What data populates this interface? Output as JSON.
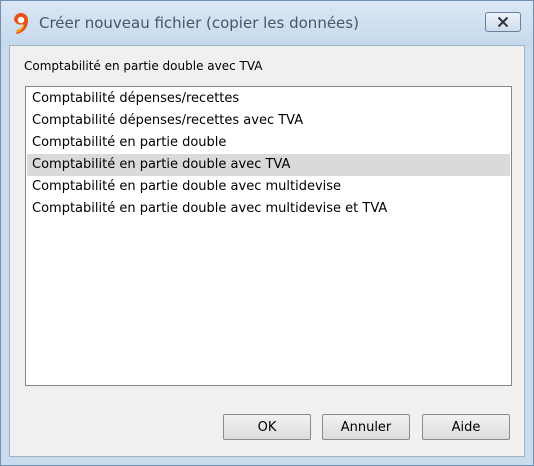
{
  "window": {
    "title": "Créer nouveau fichier (copier les données)",
    "app_icon": "banana-9-icon",
    "close_icon": "close-icon"
  },
  "label": "Comptabilité en partie double avec TVA",
  "list": {
    "items": [
      "Comptabilité dépenses/recettes",
      "Comptabilité dépenses/recettes avec TVA",
      "Comptabilité en partie double",
      "Comptabilité en partie double avec TVA",
      "Comptabilité en partie double avec multidevise",
      "Comptabilité en partie double avec multidevise et TVA"
    ],
    "selected": "Comptabilité en partie double avec TVA"
  },
  "buttons": {
    "ok": "OK",
    "cancel": "Annuler",
    "help": "Aide"
  },
  "colors": {
    "accent": "#e8511a",
    "selection": "#dadada",
    "titlebar": "#c9dcee"
  }
}
